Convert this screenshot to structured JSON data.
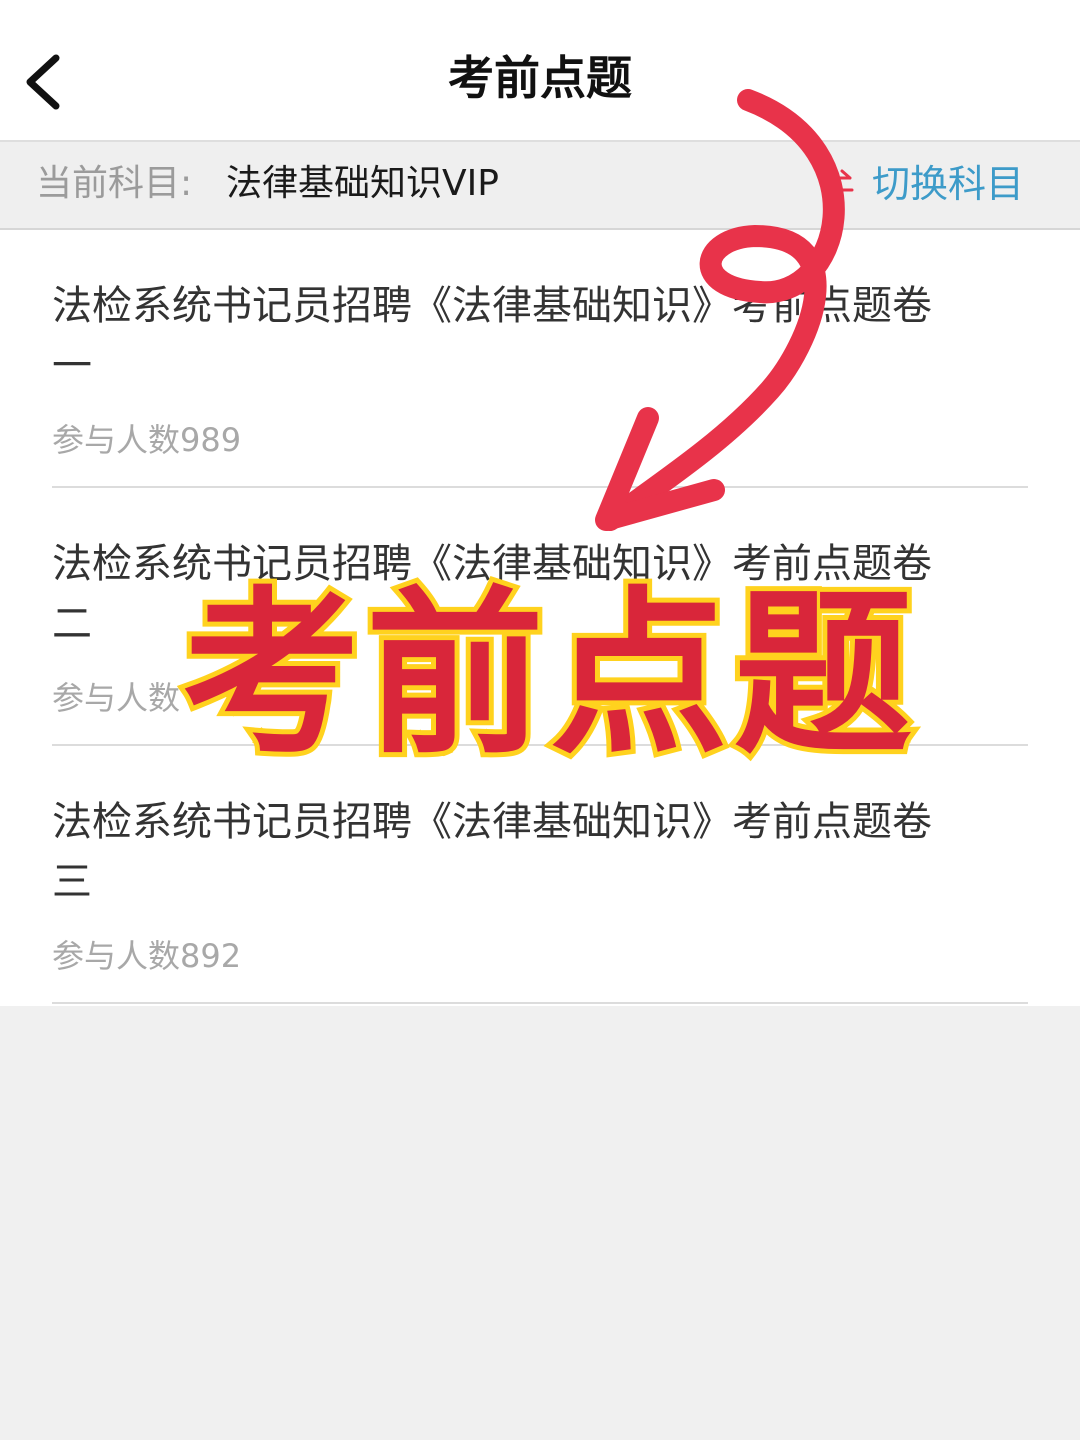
{
  "nav": {
    "title": "考前点题"
  },
  "subject": {
    "label": "当前科目:",
    "name": "法律基础知识VIP",
    "switch_label": "切换科目"
  },
  "papers": [
    {
      "title": "法检系统书记员招聘《法律基础知识》考前点题卷一",
      "participants": "参与人数989"
    },
    {
      "title": "法检系统书记员招聘《法律基础知识》考前点题卷二",
      "participants": "参与人数"
    },
    {
      "title": "法检系统书记员招聘《法律基础知识》考前点题卷三",
      "participants": "参与人数892"
    }
  ],
  "overlay": {
    "stamp_text": "考前点题",
    "arrow_color": "#e8334a",
    "stamp_color": "#d9263a",
    "stamp_outline_color": "#ffd21e"
  },
  "colors": {
    "accent": "#3d9bc9",
    "switch_icon": "#e8334a"
  }
}
